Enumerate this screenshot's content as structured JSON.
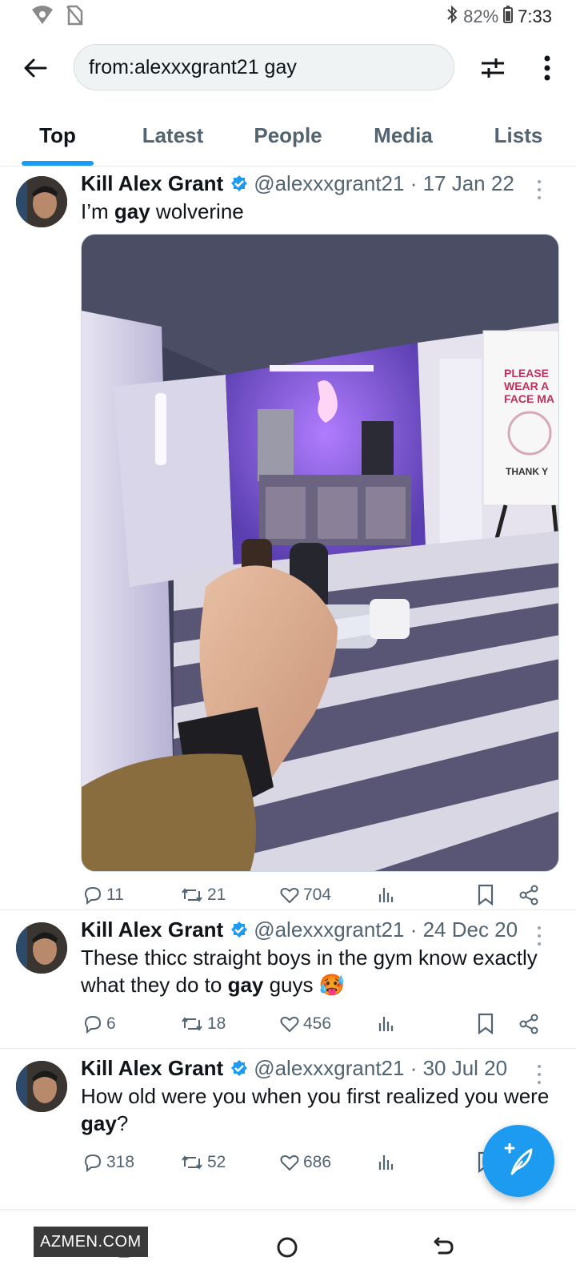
{
  "status_bar": {
    "battery": "82%",
    "time": "7:33"
  },
  "search": {
    "query": "from:alexxxgrant21 gay"
  },
  "tabs": [
    {
      "label": "Top"
    },
    {
      "label": "Latest"
    },
    {
      "label": "People"
    },
    {
      "label": "Media"
    },
    {
      "label": "Lists"
    }
  ],
  "tweets": [
    {
      "name": "Kill Alex Grant",
      "handle": "@alexxxgrant21 · 17 Jan 22",
      "text_before": "I’m ",
      "text_bold": "gay",
      "text_after": " wolverine",
      "replies": "11",
      "retweets": "21",
      "likes": "704",
      "image": {
        "sign_line1": "PLEASE",
        "sign_line2": "WEAR A",
        "sign_line3": "FACE MA",
        "sign_thanks": "THANK Y"
      }
    },
    {
      "name": "Kill Alex Grant",
      "handle": "@alexxxgrant21 · 24 Dec 20",
      "text_before": "These thicc straight boys in the gym know exactly what they do to ",
      "text_bold": "gay",
      "text_after": " guys 🥵",
      "replies": "6",
      "retweets": "18",
      "likes": "456"
    },
    {
      "name": "Kill Alex Grant",
      "handle": "@alexxxgrant21 · 30 Jul 20",
      "text_before": "How old were you when you first realized you were ",
      "text_bold": "gay",
      "text_after": "?",
      "replies": "318",
      "retweets": "52",
      "likes": "686"
    }
  ],
  "watermark": "AZMEN.COM",
  "colors": {
    "accent": "#1d9bf0",
    "text": "#0f1419",
    "muted": "#536471"
  }
}
